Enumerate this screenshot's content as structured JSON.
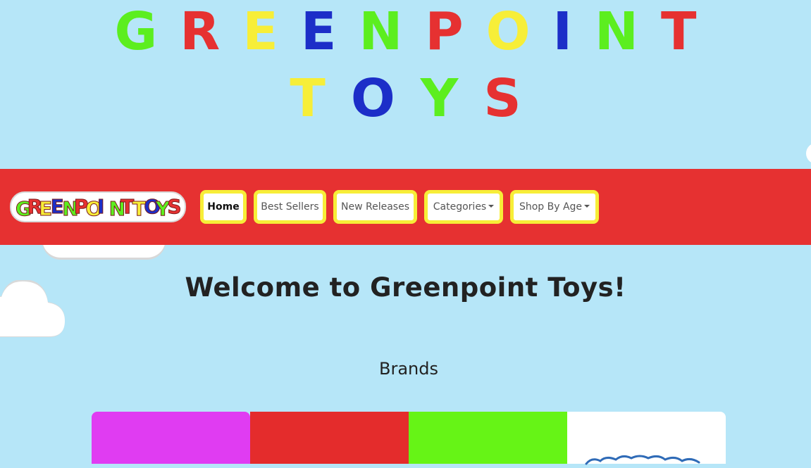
{
  "hero": {
    "line1": [
      {
        "letter": "G",
        "color": "#5cee1f"
      },
      {
        "letter": "R",
        "color": "#e63131"
      },
      {
        "letter": "E",
        "color": "#f7ee38"
      },
      {
        "letter": "E",
        "color": "#1c2ec8"
      },
      {
        "letter": "N",
        "color": "#5cee1f"
      },
      {
        "letter": "P",
        "color": "#e63131"
      },
      {
        "letter": "O",
        "color": "#f7ee38"
      },
      {
        "letter": "I",
        "color": "#1c2ec8"
      },
      {
        "letter": "N",
        "color": "#5cee1f"
      },
      {
        "letter": "T",
        "color": "#e63131"
      }
    ],
    "line2": [
      {
        "letter": "T",
        "color": "#f7ee38"
      },
      {
        "letter": "O",
        "color": "#1c2ec8"
      },
      {
        "letter": "Y",
        "color": "#5cee1f"
      },
      {
        "letter": "S",
        "color": "#e63131"
      }
    ]
  },
  "navbar": {
    "logo_text": "GREENPOINTTOYS",
    "items": [
      {
        "label": "Home",
        "active": true,
        "dropdown": false
      },
      {
        "label": "Best Sellers",
        "active": false,
        "dropdown": false
      },
      {
        "label": "New Releases",
        "active": false,
        "dropdown": false
      },
      {
        "label": "Categories",
        "active": false,
        "dropdown": true
      },
      {
        "label": "Shop By Age",
        "active": false,
        "dropdown": true
      }
    ]
  },
  "main": {
    "welcome_heading": "Welcome to Greenpoint Toys!",
    "brands_heading": "Brands"
  },
  "brands": [
    {
      "color": "#e03cf2"
    },
    {
      "color": "#e42c2c"
    },
    {
      "color": "#66f416"
    },
    {
      "color": "#ffffff"
    }
  ],
  "colors": {
    "background": "#b6e6f8",
    "navbar": "#e63131",
    "nav_border": "#f7ee38"
  }
}
